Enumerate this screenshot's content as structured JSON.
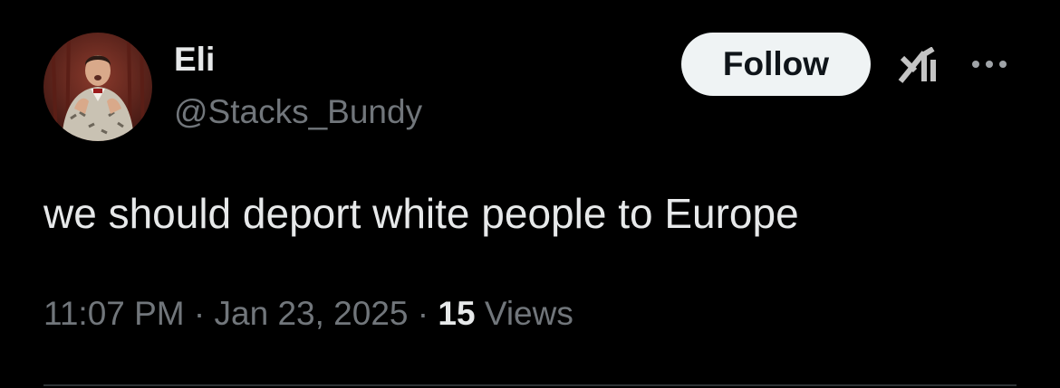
{
  "user": {
    "display_name": "Eli",
    "handle": "@Stacks_Bundy",
    "avatar_icon": "avatar-photo"
  },
  "actions": {
    "follow_label": "Follow",
    "grok_icon": "grok-icon",
    "more_icon": "more-icon"
  },
  "tweet": {
    "text": "we should deport white people to Europe",
    "time": "11:07 PM",
    "separator": "·",
    "date": "Jan 23, 2025",
    "views_count": "15",
    "views_label": "Views"
  },
  "colors": {
    "background": "#000000",
    "primary_text": "#e7e9ea",
    "secondary_text": "#71767b",
    "button_bg": "#eff3f4",
    "button_text": "#0f1419",
    "divider": "#2f3336"
  }
}
